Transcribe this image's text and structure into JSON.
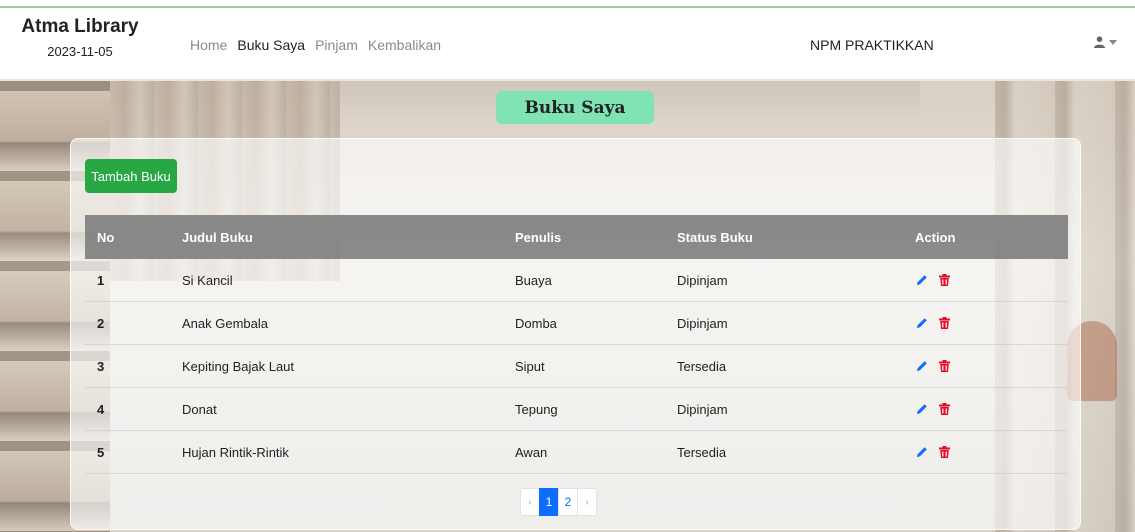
{
  "navbar": {
    "brand_title": "Atma Library",
    "date": "2023-11-05",
    "links": [
      {
        "label": "Home",
        "active": false
      },
      {
        "label": "Buku Saya",
        "active": true
      },
      {
        "label": "Pinjam",
        "active": false
      },
      {
        "label": "Kembalikan",
        "active": false
      }
    ],
    "npm_label": "NPM PRAKTIKKAN",
    "user_icon": "user-icon",
    "dropdown_icon": "caret-down-icon"
  },
  "page": {
    "title": "Buku Saya",
    "add_button_label": "Tambah Buku"
  },
  "table": {
    "headers": [
      "No",
      "Judul Buku",
      "Penulis",
      "Status Buku",
      "Action"
    ],
    "rows": [
      {
        "no": "1",
        "judul": "Si Kancil",
        "penulis": "Buaya",
        "status": "Dipinjam"
      },
      {
        "no": "2",
        "judul": "Anak Gembala",
        "penulis": "Domba",
        "status": "Dipinjam"
      },
      {
        "no": "3",
        "judul": "Kepiting Bajak Laut",
        "penulis": "Siput",
        "status": "Tersedia"
      },
      {
        "no": "4",
        "judul": "Donat",
        "penulis": "Tepung",
        "status": "Dipinjam"
      },
      {
        "no": "5",
        "judul": "Hujan Rintik-Rintik",
        "penulis": "Awan",
        "status": "Tersedia"
      }
    ],
    "action_icons": [
      "pencil-icon",
      "trash-icon"
    ]
  },
  "pagination": {
    "prev": "‹",
    "pages": [
      "1",
      "2"
    ],
    "active_page": "1",
    "next": "›"
  },
  "colors": {
    "title_badge": "#7fe3b4",
    "add_button": "#28a745",
    "table_header": "#808080",
    "edit_icon": "#0d6efd",
    "delete_icon": "#e0102c",
    "page_active": "#0d6efd"
  }
}
